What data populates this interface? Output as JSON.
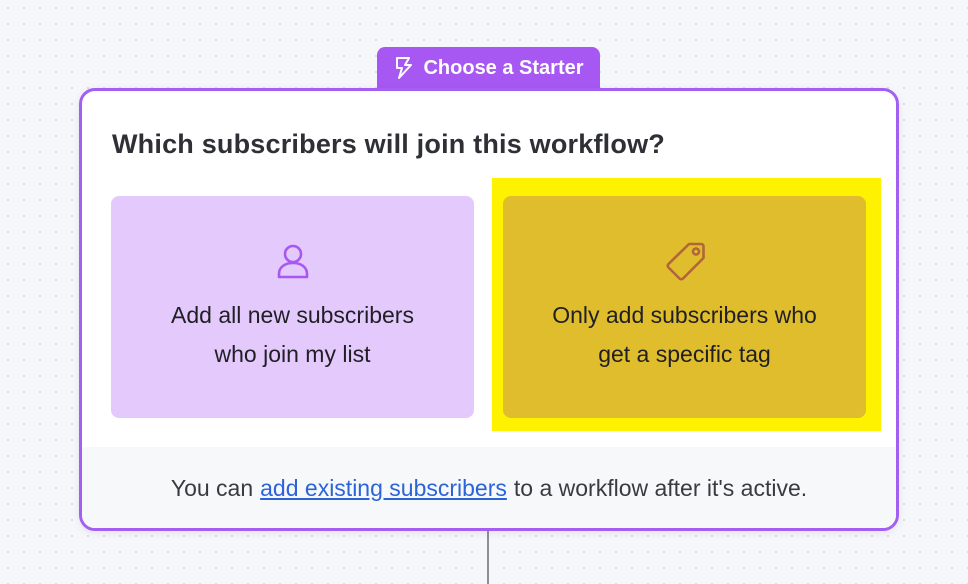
{
  "starter": {
    "label": "Choose a Starter",
    "icon": "lightning-bolt-icon"
  },
  "card": {
    "question": "Which subscribers will join this workflow?",
    "options": [
      {
        "icon": "user-icon",
        "line1": "Add all new subscribers",
        "line2": "who join my list",
        "color": "#e4c9fd"
      },
      {
        "icon": "tag-icon",
        "line1": "Only add subscribers who",
        "line2": "get a specific tag",
        "color": "#e0bd2c",
        "highlighted": true
      }
    ],
    "footer": {
      "prefix": "You can",
      "link": "add existing subscribers",
      "suffix": "to a workflow after it's active."
    }
  },
  "colors": {
    "accent": "#a858f2",
    "link": "#2b63d9",
    "highlight": "#fff200"
  }
}
